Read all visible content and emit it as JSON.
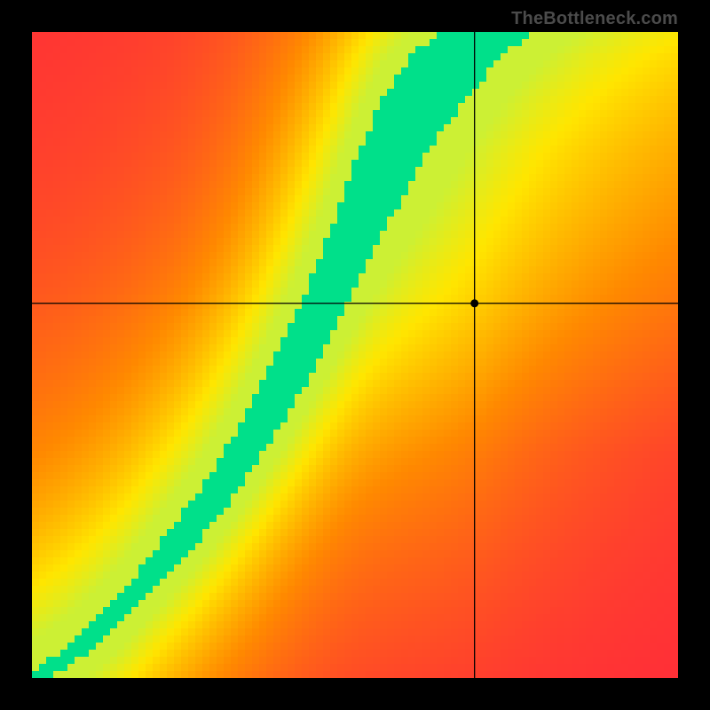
{
  "watermark": "TheBottleneck.com",
  "colors": {
    "background": "#000000",
    "watermark": "#4b4b4b",
    "crosshair": "#000000",
    "marker": "#000000",
    "heat_low": "#ff2a3b",
    "heat_mid1": "#ff8a00",
    "heat_mid2": "#ffe600",
    "heat_high": "#00e08a"
  },
  "layout": {
    "image_size": 800,
    "plot_margin": 36,
    "plot_size": 728,
    "pixel_grid": 91
  },
  "chart_data": {
    "type": "heatmap",
    "title": "",
    "xlabel": "",
    "ylabel": "",
    "xlim": [
      0,
      1
    ],
    "ylim": [
      0,
      1
    ],
    "grid": false,
    "legend": false,
    "annotations": [
      "TheBottleneck.com"
    ],
    "crosshair": {
      "x": 0.685,
      "y": 0.58
    },
    "ridge_points": [
      {
        "x": 0.0,
        "y": 0.0
      },
      {
        "x": 0.05,
        "y": 0.03
      },
      {
        "x": 0.1,
        "y": 0.07
      },
      {
        "x": 0.15,
        "y": 0.12
      },
      {
        "x": 0.2,
        "y": 0.18
      },
      {
        "x": 0.25,
        "y": 0.24
      },
      {
        "x": 0.3,
        "y": 0.31
      },
      {
        "x": 0.35,
        "y": 0.39
      },
      {
        "x": 0.4,
        "y": 0.48
      },
      {
        "x": 0.45,
        "y": 0.58
      },
      {
        "x": 0.5,
        "y": 0.7
      },
      {
        "x": 0.55,
        "y": 0.82
      },
      {
        "x": 0.6,
        "y": 0.9
      },
      {
        "x": 0.65,
        "y": 0.96
      },
      {
        "x": 0.7,
        "y": 1.0
      }
    ],
    "ridge_width": [
      {
        "x": 0.0,
        "w": 0.01
      },
      {
        "x": 0.2,
        "w": 0.03
      },
      {
        "x": 0.4,
        "w": 0.055
      },
      {
        "x": 0.55,
        "w": 0.065
      },
      {
        "x": 0.7,
        "w": 0.075
      }
    ],
    "field_description": "Pixelated heatmap. A narrow green optimal band runs diagonally from the bottom-left corner upward, curving with increasing steepness, exiting the top edge near x≈0.6. Surrounding the band the field fades through yellow and orange to red. The upper-right region (above the band, right of the curve) is broadly yellow/orange; the lower-right and upper-left corners are red. A black crosshair marks a point to the right of the green band.",
    "colormap_stops": [
      {
        "value": 0.0,
        "color": "#ff2a3b"
      },
      {
        "value": 0.4,
        "color": "#ff8a00"
      },
      {
        "value": 0.7,
        "color": "#ffe600"
      },
      {
        "value": 0.9,
        "color": "#c7f23a"
      },
      {
        "value": 1.0,
        "color": "#00e08a"
      }
    ]
  }
}
